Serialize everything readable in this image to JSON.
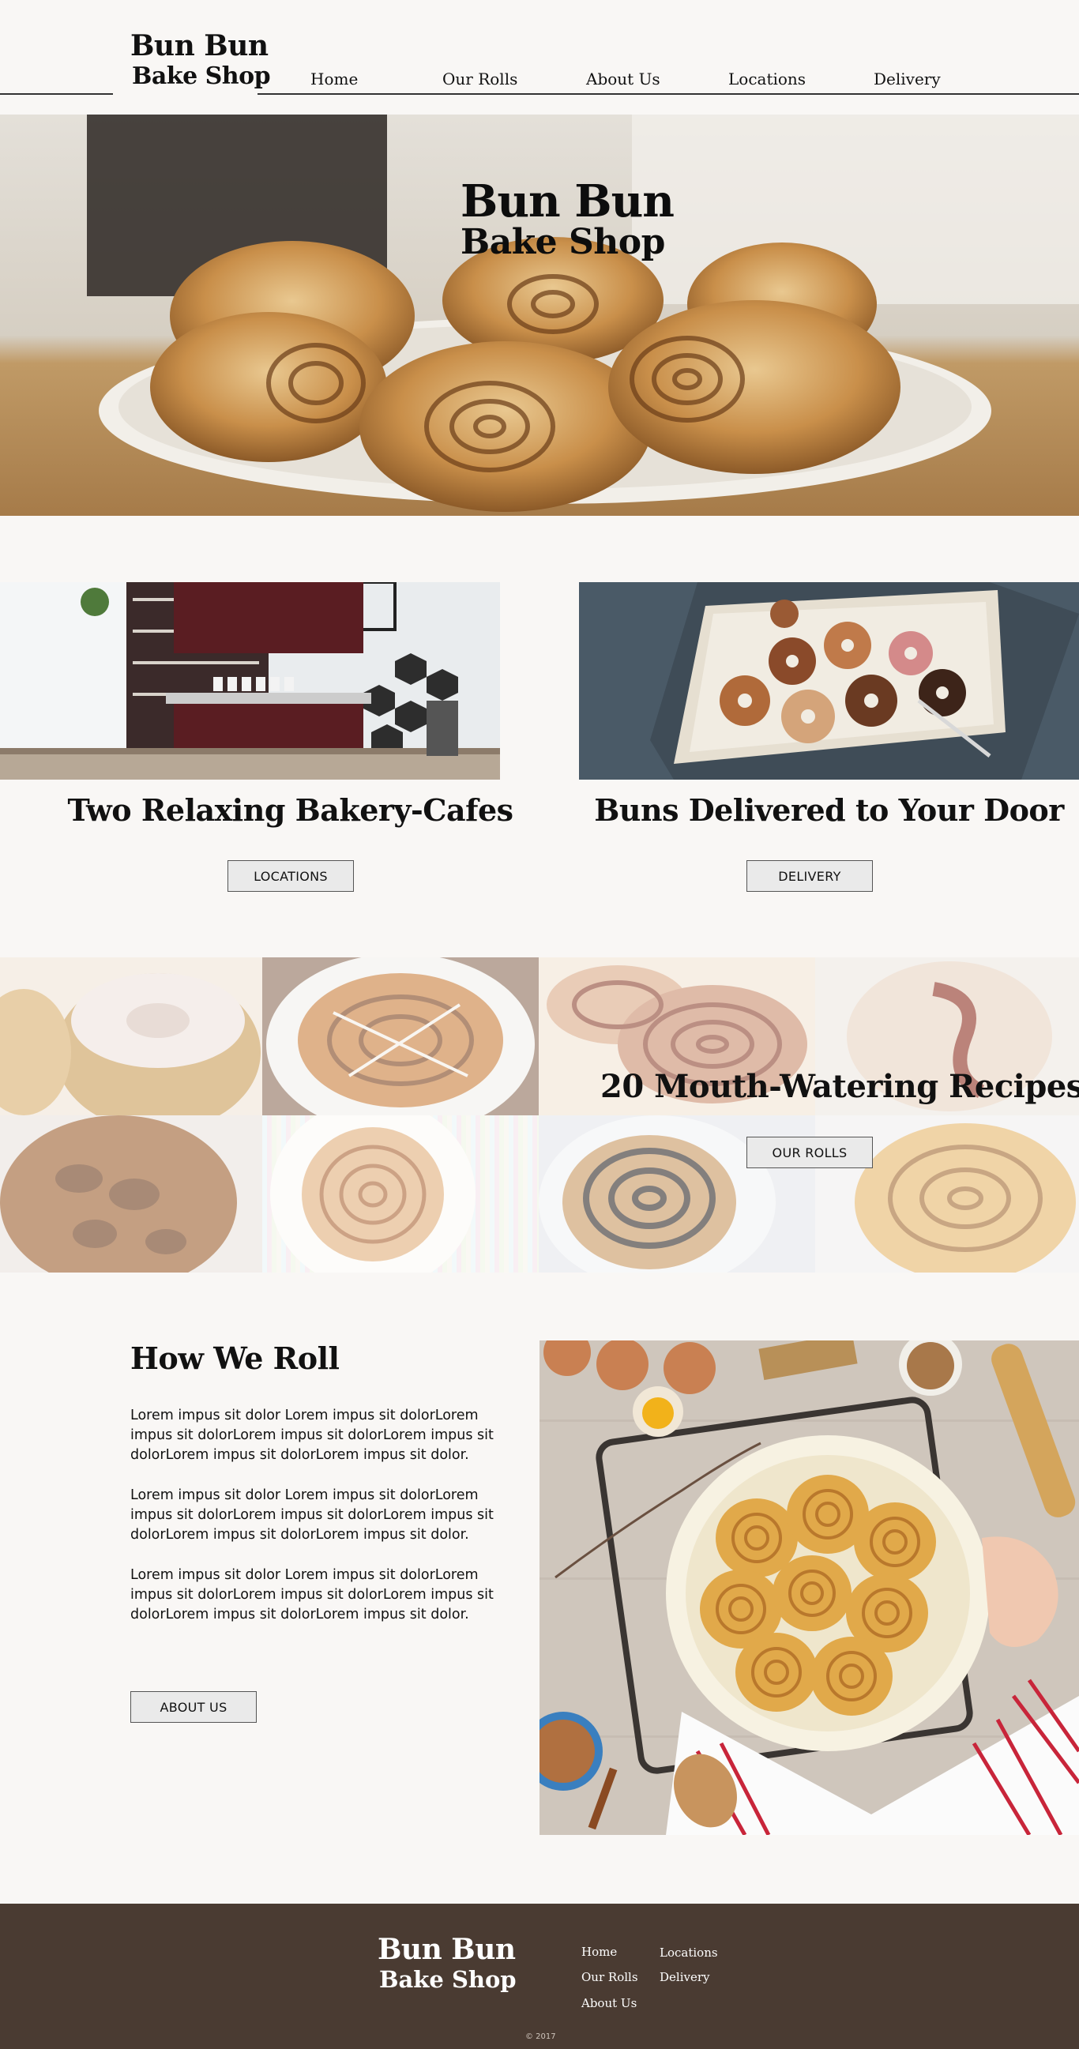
{
  "header": {
    "logo_line1": "Bun Bun",
    "logo_line2": "Bake Shop",
    "nav": [
      {
        "label": "Home"
      },
      {
        "label": "Our Rolls"
      },
      {
        "label": "About Us"
      },
      {
        "label": "Locations"
      },
      {
        "label": "Delivery"
      }
    ]
  },
  "hero": {
    "title_line1": "Bun Bun",
    "title_line2": "Bake Shop"
  },
  "features": {
    "cafes": {
      "title": "Two Relaxing Bakery-Cafes",
      "button": "LOCATIONS"
    },
    "delivery": {
      "title": "Buns Delivered to Your Door",
      "button": "DELIVERY"
    }
  },
  "recipes": {
    "title": "20 Mouth-Watering Recipes",
    "button": "OUR ROLLS"
  },
  "about": {
    "title": "How We Roll",
    "paragraphs": [
      "Lorem impus sit dolor Lorem impus sit dolorLorem impus sit dolorLorem impus sit dolorLorem impus sit dolorLorem impus sit dolorLorem impus sit dolor.",
      "Lorem impus sit dolor Lorem impus sit dolorLorem impus sit dolorLorem impus sit dolorLorem impus sit dolorLorem impus sit dolorLorem impus sit dolor.",
      "Lorem impus sit dolor Lorem impus sit dolorLorem impus sit dolorLorem impus sit dolorLorem impus sit dolorLorem impus sit dolorLorem impus sit dolor."
    ],
    "button": "ABOUT US"
  },
  "footer": {
    "logo_line1": "Bun Bun",
    "logo_line2": "Bake Shop",
    "links": [
      {
        "label": "Home"
      },
      {
        "label": "Our Rolls"
      },
      {
        "label": "About Us"
      },
      {
        "label": "Locations"
      },
      {
        "label": "Delivery"
      }
    ],
    "copyright": "© 2017"
  },
  "colors": {
    "page_bg": "#f9f7f5",
    "footer_bg": "#4a3b32",
    "button_bg": "#eaeaea",
    "text": "#111111"
  }
}
